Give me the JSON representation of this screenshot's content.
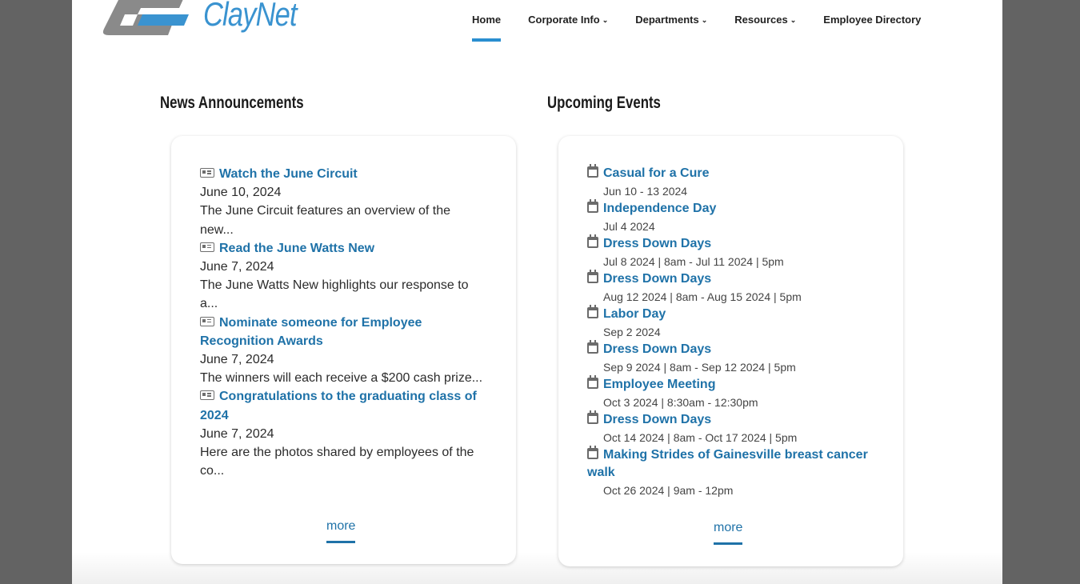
{
  "brand": {
    "name": "ClayNet",
    "logo_gray": "#8a8a8a",
    "logo_blue": "#3a93d0"
  },
  "nav": {
    "items": [
      {
        "label": "Home",
        "active": true,
        "dropdown": false
      },
      {
        "label": "Corporate Info",
        "active": false,
        "dropdown": true
      },
      {
        "label": "Departments",
        "active": false,
        "dropdown": true
      },
      {
        "label": "Resources",
        "active": false,
        "dropdown": true
      },
      {
        "label": "Employee Directory",
        "active": false,
        "dropdown": false
      }
    ],
    "caret": "⌄"
  },
  "news": {
    "heading": "News Announcements",
    "items": [
      {
        "title": "Watch the June Circuit",
        "date": "June 10, 2024",
        "desc": "The June Circuit features an overview of the new..."
      },
      {
        "title": "Read the June Watts New",
        "date": "June 7, 2024",
        "desc": "The June Watts New highlights our response to a..."
      },
      {
        "title": "Nominate someone for Employee Recognition Awards",
        "date": "June 7, 2024",
        "desc": "The winners will each receive a $200 cash prize..."
      },
      {
        "title": "Congratulations to the graduating class of 2024",
        "date": "June 7, 2024",
        "desc": "Here are the photos shared by employees of the co..."
      }
    ],
    "more_label": "more"
  },
  "events": {
    "heading": "Upcoming Events",
    "items": [
      {
        "title": "Casual for a Cure",
        "when": "Jun 10 - 13 2024"
      },
      {
        "title": "Independence Day",
        "when": "Jul 4 2024"
      },
      {
        "title": "Dress Down Days",
        "when": "Jul 8 2024 | 8am - Jul 11 2024 | 5pm"
      },
      {
        "title": "Dress Down Days",
        "when": "Aug 12 2024 | 8am - Aug 15 2024 | 5pm"
      },
      {
        "title": "Labor Day",
        "when": "Sep 2 2024"
      },
      {
        "title": "Dress Down Days",
        "when": "Sep 9 2024 | 8am - Sep 12 2024 | 5pm"
      },
      {
        "title": "Employee Meeting",
        "when": "Oct 3 2024 | 8:30am - 12:30pm"
      },
      {
        "title": "Dress Down Days",
        "when": "Oct 14 2024 | 8am - Oct 17 2024 | 5pm"
      },
      {
        "title": "Making Strides of Gainesville breast cancer walk",
        "when": "Oct 26 2024 | 9am - 12pm"
      }
    ],
    "more_label": "more"
  },
  "colors": {
    "link": "#1f72a8",
    "accent": "#2a8fd0",
    "backdrop": "#636363"
  }
}
